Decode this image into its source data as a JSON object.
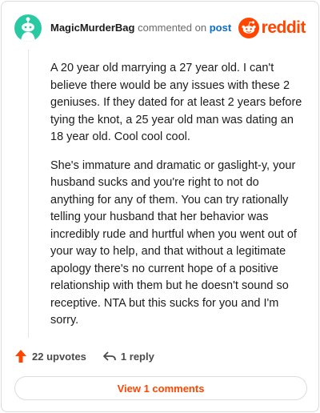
{
  "comment": {
    "author": "MagicMurderBag",
    "action": "commented on",
    "target": "post",
    "paragraphs": [
      "A 20 year old marrying a 27 year old. I can't believe there would be any issues with these 2 geniuses. If they dated for at least 2 years before tying the knot, a 25 year old man was dating an 18 year old. Cool cool cool.",
      "She's immature and dramatic or gaslight-y, your husband sucks and you're right to not do anything for any of them. You can try rationally telling your husband that her behavior was incredibly rude and hurtful when you went out of your way to help, and that without a legitimate apology there's no current hope of a positive relationship with them but he doesn't sound so receptive. NTA but this sucks for you and I'm sorry."
    ],
    "upvotes": "22 upvotes",
    "replies": "1 reply",
    "view_button": "View 1 comments"
  },
  "brand": {
    "wordmark": "reddit",
    "color": "#ff4500"
  },
  "colors": {
    "avatar": "#29c9a4",
    "link": "#0a6ec8",
    "accent": "#ff4500"
  },
  "icons": {
    "avatar": "snoo-avatar-icon",
    "logo": "reddit-snoo-icon",
    "upvote": "upvote-arrow-icon",
    "reply": "reply-arrow-icon"
  }
}
